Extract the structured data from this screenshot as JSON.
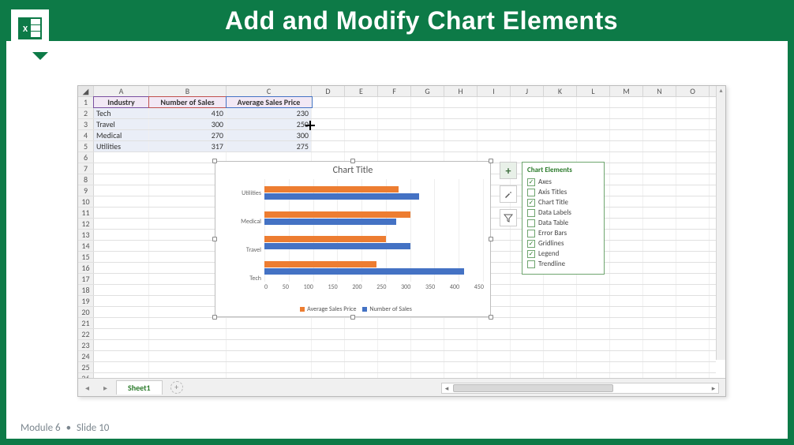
{
  "slide": {
    "title": "Add and Modify Chart Elements",
    "module": "Module 6",
    "slide_num": "Slide 10"
  },
  "spreadsheet": {
    "columns": [
      "A",
      "B",
      "C",
      "D",
      "E",
      "F",
      "G",
      "H",
      "I",
      "J",
      "K",
      "L",
      "M",
      "N",
      "O"
    ],
    "row_count": 26,
    "headers": {
      "A": "Industry",
      "B": "Number of Sales",
      "C": "Average Sales Price"
    },
    "data": [
      {
        "industry": "Tech",
        "sales": "410",
        "price": "230"
      },
      {
        "industry": "Travel",
        "sales": "300",
        "price": "250"
      },
      {
        "industry": "Medical",
        "sales": "270",
        "price": "300"
      },
      {
        "industry": "Utilities",
        "sales": "317",
        "price": "275"
      }
    ],
    "sheet_tab": "Sheet1"
  },
  "chart_data": {
    "type": "bar",
    "title": "Chart Title",
    "categories": [
      "Utilities",
      "Medical",
      "Travel",
      "Tech"
    ],
    "series": [
      {
        "name": "Average Sales Price",
        "color": "#ed7d31",
        "values": [
          275,
          300,
          250,
          230
        ]
      },
      {
        "name": "Number of Sales",
        "color": "#4472c4",
        "values": [
          317,
          270,
          300,
          410
        ]
      }
    ],
    "xaxis_ticks": [
      "0",
      "50",
      "100",
      "150",
      "200",
      "250",
      "300",
      "350",
      "400",
      "450"
    ],
    "xlim": [
      0,
      450
    ]
  },
  "chart_elements_panel": {
    "title": "Chart Elements",
    "items": [
      {
        "label": "Axes",
        "checked": true
      },
      {
        "label": "Axis Titles",
        "checked": false
      },
      {
        "label": "Chart Title",
        "checked": true
      },
      {
        "label": "Data Labels",
        "checked": false
      },
      {
        "label": "Data Table",
        "checked": false
      },
      {
        "label": "Error Bars",
        "checked": false
      },
      {
        "label": "Gridlines",
        "checked": true
      },
      {
        "label": "Legend",
        "checked": true
      },
      {
        "label": "Trendline",
        "checked": false
      }
    ]
  },
  "side_buttons": {
    "plus": "+",
    "brush": "🖌",
    "filter": "▾"
  }
}
